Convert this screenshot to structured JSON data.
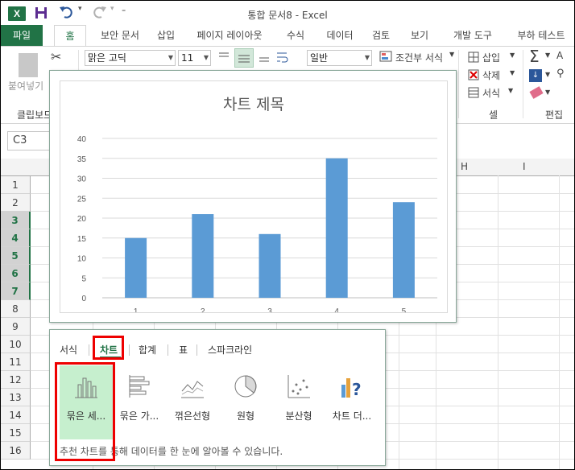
{
  "app": {
    "logo": "X",
    "window_title": "통합 문서8 - Excel"
  },
  "quick_access": {
    "save_icon": "save-icon",
    "undo_icon": "undo-icon",
    "redo_icon": "redo-icon",
    "customize_icon": "customize-icon"
  },
  "tabs": [
    {
      "label": "파일"
    },
    {
      "label": "홈"
    },
    {
      "label": "보안 문서"
    },
    {
      "label": "삽입"
    },
    {
      "label": "페이지 레이아웃"
    },
    {
      "label": "수식"
    },
    {
      "label": "데이터"
    },
    {
      "label": "검토"
    },
    {
      "label": "보기"
    },
    {
      "label": "개발 도구"
    },
    {
      "label": "부하 테스트"
    }
  ],
  "ribbon": {
    "paste_label": "붙여넣기",
    "clipboard_group": "클립보드",
    "font_name": "맑은 고딕",
    "font_size": "11",
    "number_format": "일반",
    "conditional_format": "조건부 서식",
    "insert": "삽입",
    "delete": "삭제",
    "format": "서식",
    "cells_group": "셀",
    "editing_group": "편집"
  },
  "formula_bar": {
    "name_box": "C3"
  },
  "columns": {
    "H": "H",
    "I": "I"
  },
  "rows": [
    "1",
    "2",
    "3",
    "4",
    "5",
    "6",
    "7",
    "8",
    "9",
    "10",
    "11",
    "12",
    "13",
    "14",
    "15",
    "16"
  ],
  "chart_data": {
    "type": "bar",
    "title": "차트 제목",
    "categories": [
      "1",
      "2",
      "3",
      "4",
      "5"
    ],
    "values": [
      15,
      21,
      16,
      35,
      24
    ],
    "ylim": [
      0,
      40
    ],
    "yticks": [
      "0",
      "5",
      "10",
      "15",
      "20",
      "25",
      "30",
      "35",
      "40"
    ],
    "grid": true,
    "bar_color": "#5b9bd5"
  },
  "quick_analysis": {
    "tabs": [
      {
        "label": "서식"
      },
      {
        "label": "차트"
      },
      {
        "label": "합계"
      },
      {
        "label": "표"
      },
      {
        "label": "스파크라인"
      }
    ],
    "items": [
      {
        "label": "묶은 세...",
        "icon": "clustered-column-icon"
      },
      {
        "label": "묶은 가...",
        "icon": "clustered-bar-icon"
      },
      {
        "label": "꺾은선형",
        "icon": "line-chart-icon"
      },
      {
        "label": "원형",
        "icon": "pie-chart-icon"
      },
      {
        "label": "분산형",
        "icon": "scatter-chart-icon"
      },
      {
        "label": "차트 더...",
        "icon": "more-charts-icon"
      }
    ],
    "footer": "추천 차트를 통해 데이터를 한 눈에 알아볼 수 있습니다."
  },
  "colors": {
    "excel_green": "#217346",
    "highlight_red": "#e00000",
    "selected_green": "#c6efce"
  }
}
